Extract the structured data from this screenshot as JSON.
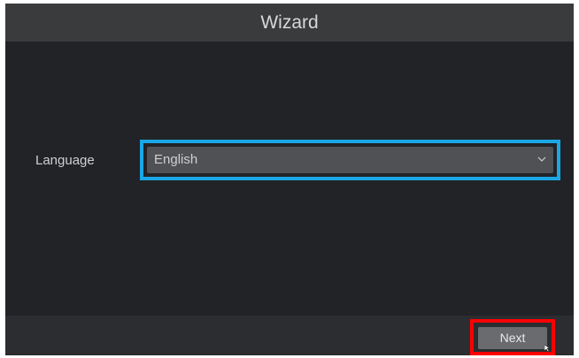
{
  "window": {
    "title": "Wizard"
  },
  "language": {
    "label": "Language",
    "selected": "English",
    "icon": "chevron-down-icon"
  },
  "footer": {
    "next_label": "Next"
  },
  "colors": {
    "title_bar": "#3a3b3d",
    "background": "#222327",
    "select_bg": "#505155",
    "select_highlight": "#1aa7e6",
    "next_highlight": "#ff0000",
    "next_button": "#6a6b6e"
  }
}
